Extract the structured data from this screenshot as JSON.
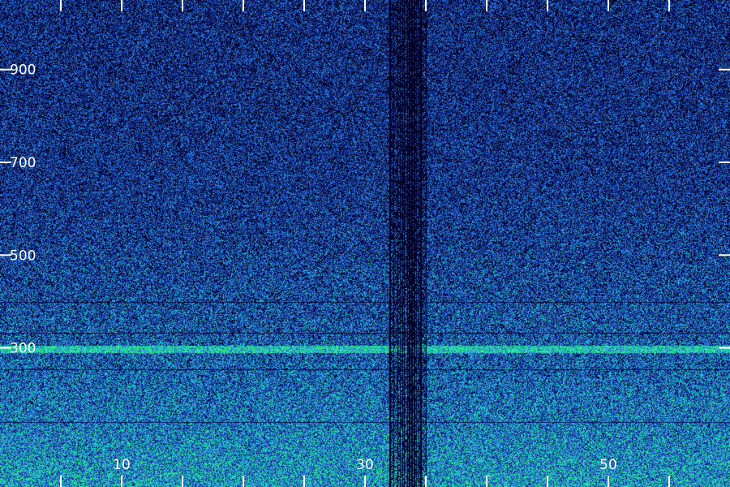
{
  "chart_data": {
    "type": "heatmap",
    "title": "",
    "xlabel": "",
    "ylabel": "",
    "xlim": [
      0,
      60
    ],
    "ylim": [
      0,
      1050
    ],
    "x_ticks": [
      0,
      5,
      10,
      15,
      20,
      25,
      30,
      35,
      40,
      45,
      50,
      55
    ],
    "x_tick_labels": [
      {
        "value": 10,
        "text": "10"
      },
      {
        "value": 30,
        "text": "30"
      },
      {
        "value": 50,
        "text": "50"
      }
    ],
    "y_ticks": [
      300,
      500,
      700,
      900
    ],
    "y_tick_labels": [
      {
        "value": 300,
        "text": "300"
      },
      {
        "value": 500,
        "text": "500"
      },
      {
        "value": 700,
        "text": "700"
      },
      {
        "value": 900,
        "text": "900"
      }
    ],
    "colormap": [
      "#000022",
      "#0a1e78",
      "#1f4fc4",
      "#2c8cd8",
      "#20d8c0",
      "#30f080"
    ],
    "features": {
      "dropout_band_x": [
        32,
        35
      ],
      "strong_band_y": [
        290,
        305
      ],
      "intensity_trend": "higher at low y, decreasing upward"
    }
  }
}
